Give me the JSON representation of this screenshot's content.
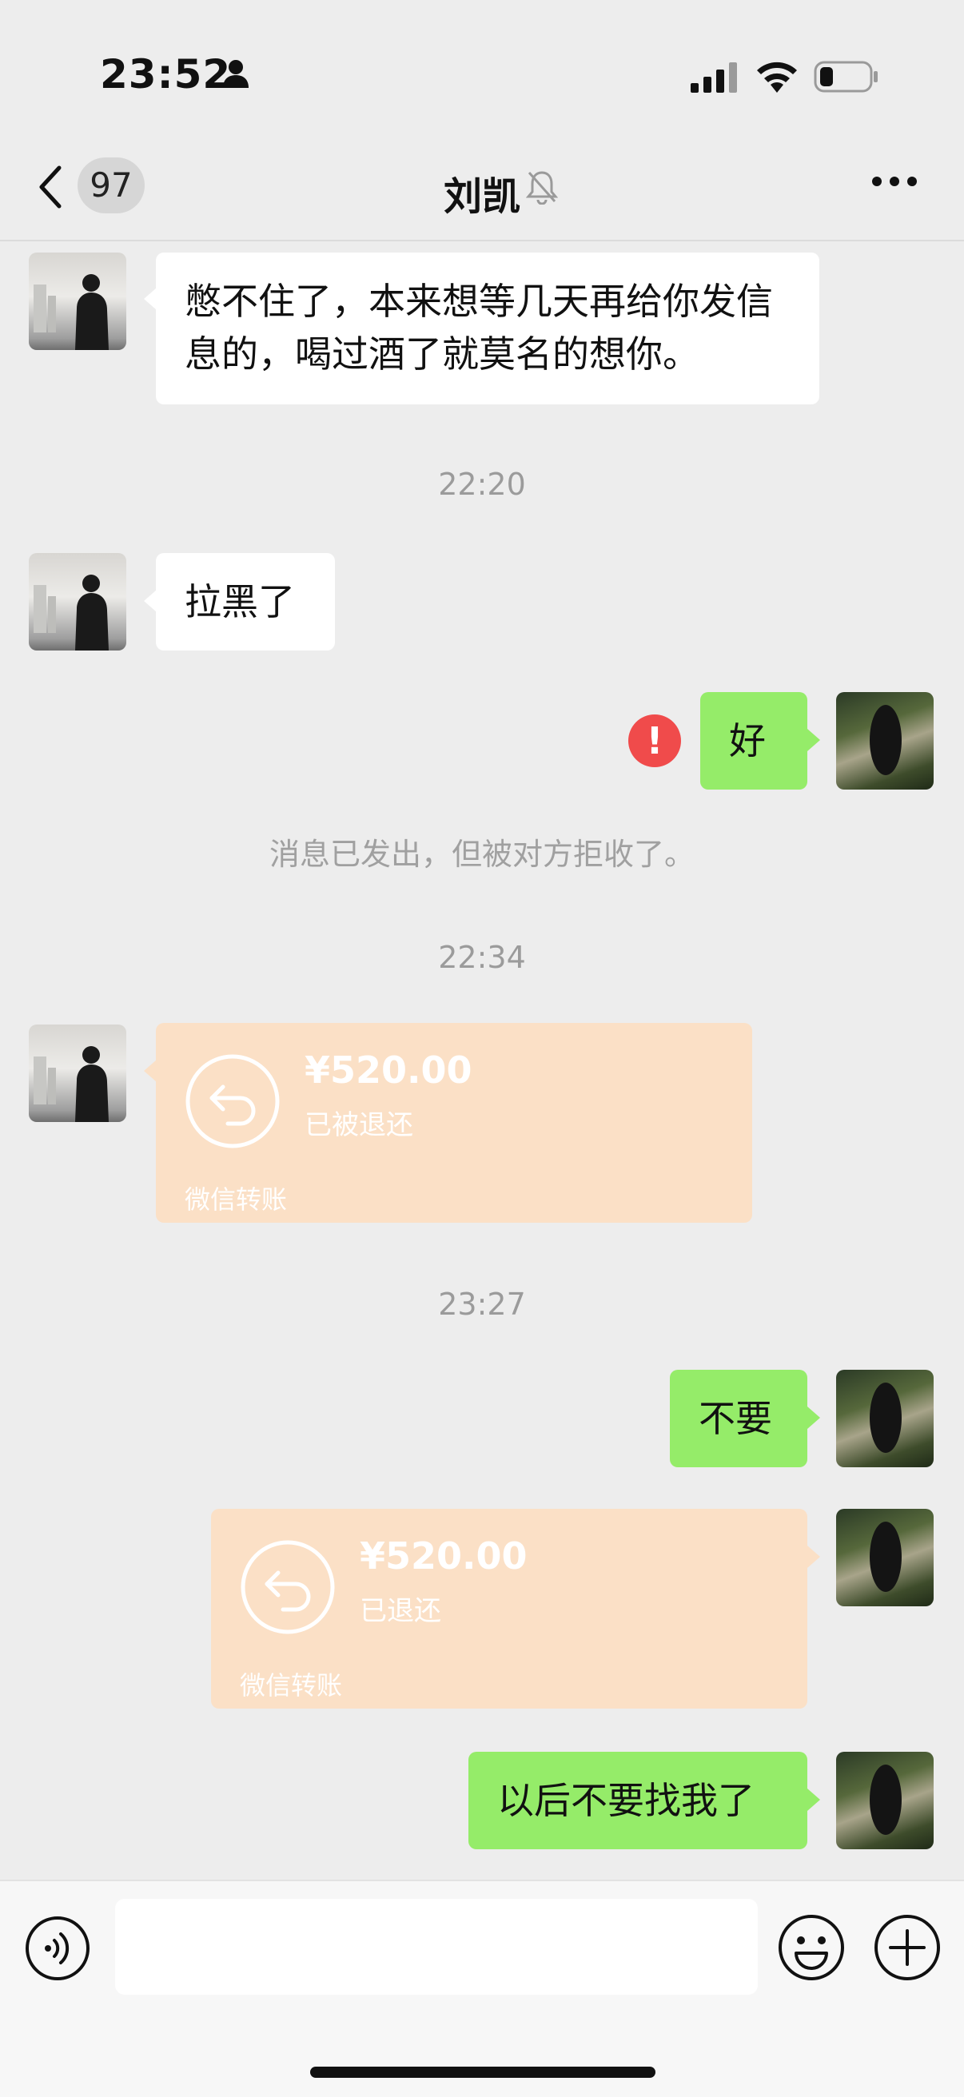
{
  "status_bar": {
    "time": "23:52"
  },
  "nav": {
    "unread_count": "97",
    "title": "刘凯"
  },
  "messages": {
    "m1": "憋不住了，本来想等几天再给你发信息的，喝过酒了就莫名的想你。",
    "t1": "22:20",
    "m2": "拉黑了",
    "m3": "好",
    "error_mark": "!",
    "notice": "消息已发出，但被对方拒收了。",
    "t2": "22:34",
    "transfer1": {
      "amount": "¥520.00",
      "status": "已被退还",
      "label": "微信转账"
    },
    "t3": "23:27",
    "m4": "不要",
    "transfer2": {
      "amount": "¥520.00",
      "status": "已退还",
      "label": "微信转账"
    },
    "m5": "以后不要找我了"
  },
  "input": {
    "placeholder": ""
  },
  "colors": {
    "background": "#ededed",
    "sent_bubble": "#95ec69",
    "received_bubble": "#ffffff",
    "transfer_refunded": "#fbe0c6",
    "error": "#f04b4b"
  }
}
